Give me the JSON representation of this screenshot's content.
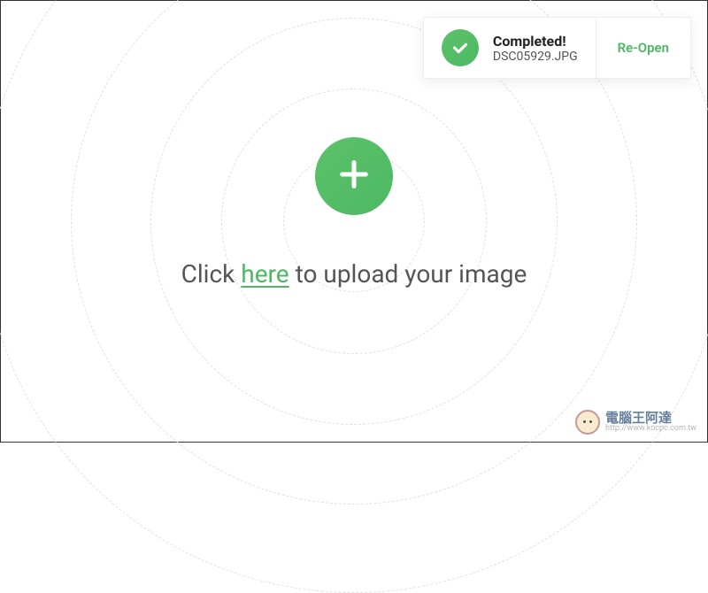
{
  "toast": {
    "title": "Completed!",
    "filename": "DSC05929.JPG",
    "action": "Re-Open"
  },
  "upload": {
    "text_before": "Click ",
    "link": "here",
    "text_after": " to upload your image"
  },
  "watermark": {
    "brand": "電腦王阿達",
    "url": "http://www.kocpc.com.tw"
  },
  "icons": {
    "plus": "plus-icon",
    "check": "check-icon"
  },
  "colors": {
    "accent": "#4db863"
  }
}
